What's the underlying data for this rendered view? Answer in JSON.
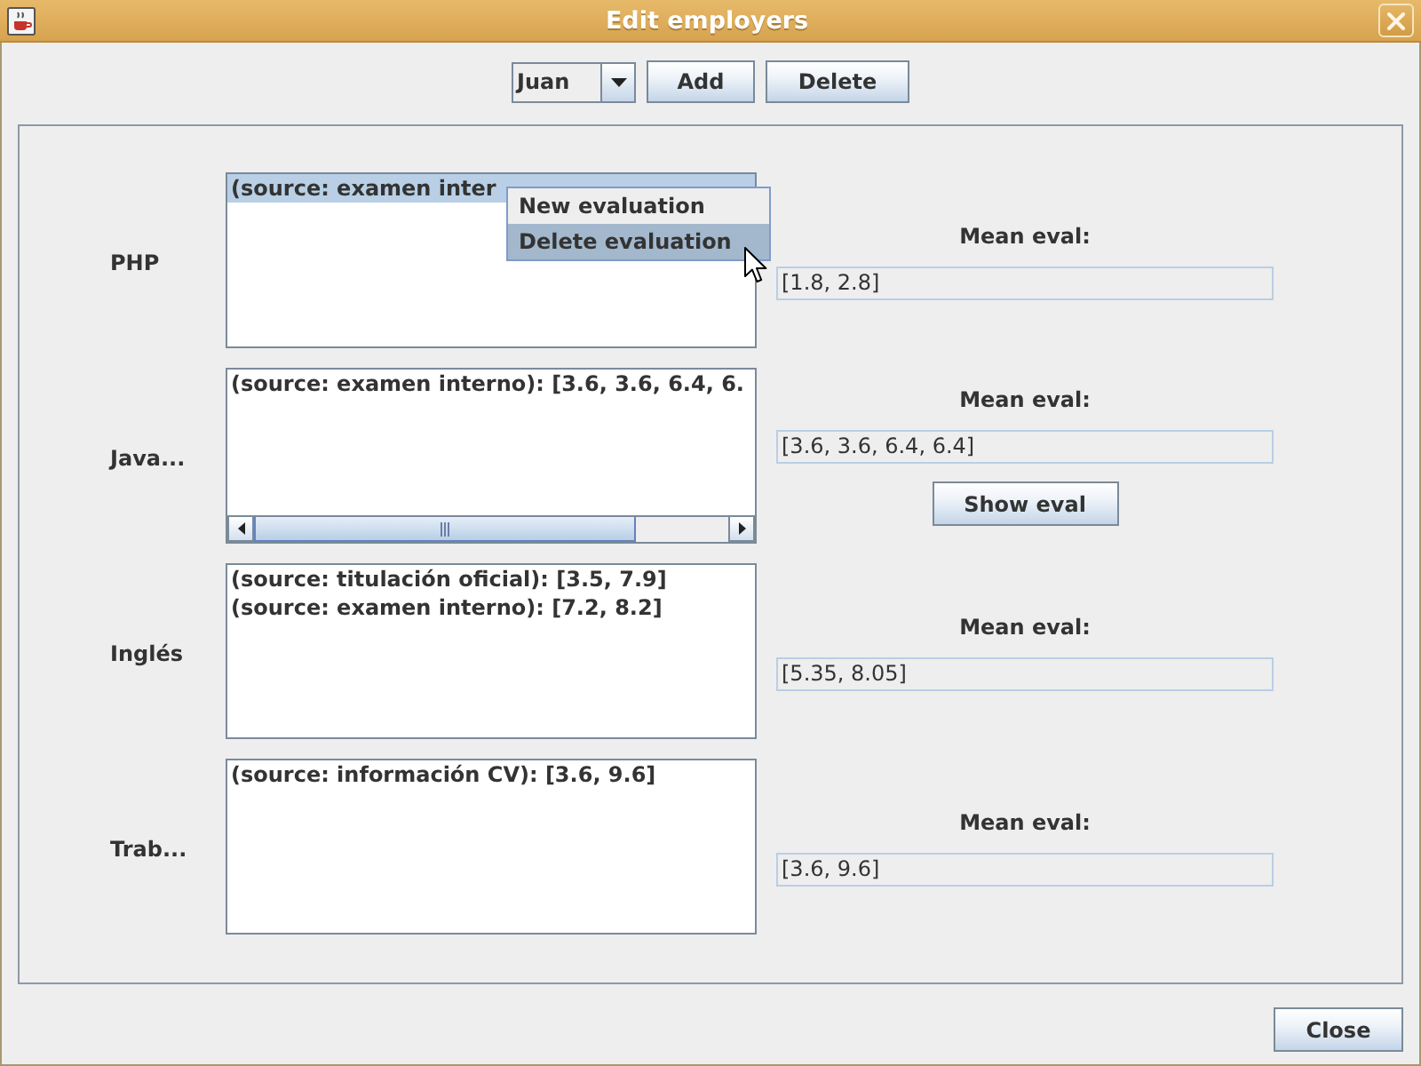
{
  "window": {
    "title": "Edit employers"
  },
  "employee_selector": {
    "value": "Juan",
    "buttons": [
      "Add",
      "Delete"
    ]
  },
  "skills": [
    {
      "name": "PHP",
      "evaluations": [
        {
          "text": "(source: examen inter",
          "selected": true
        }
      ],
      "mean_label": "Mean eval:",
      "mean_value": "[1.8, 2.8]",
      "horizontal_scrollbar": false
    },
    {
      "name": "Java...",
      "evaluations": [
        {
          "text": "(source: examen interno): [3.6, 3.6, 6.4, 6.",
          "selected": false
        }
      ],
      "mean_label": "Mean eval:",
      "mean_value": "[3.6, 3.6, 6.4, 6.4]",
      "horizontal_scrollbar": true,
      "button": "Show eval"
    },
    {
      "name": "Inglés",
      "evaluations": [
        {
          "text": "(source: titulación oficial): [3.5, 7.9]",
          "selected": false
        },
        {
          "text": "(source: examen interno): [7.2, 8.2]",
          "selected": false
        }
      ],
      "mean_label": "Mean eval:",
      "mean_value": "[5.35, 8.05]",
      "horizontal_scrollbar": false
    },
    {
      "name": "Trab...",
      "evaluations": [
        {
          "text": "(source: información CV): [3.6, 9.6]",
          "selected": false
        }
      ],
      "mean_label": "Mean eval:",
      "mean_value": "[3.6, 9.6]",
      "horizontal_scrollbar": false
    }
  ],
  "context_menu": {
    "items": [
      {
        "label": "New evaluation",
        "selected": false
      },
      {
        "label": "Delete evaluation",
        "selected": true
      }
    ]
  },
  "buttons": [
    "Close"
  ]
}
